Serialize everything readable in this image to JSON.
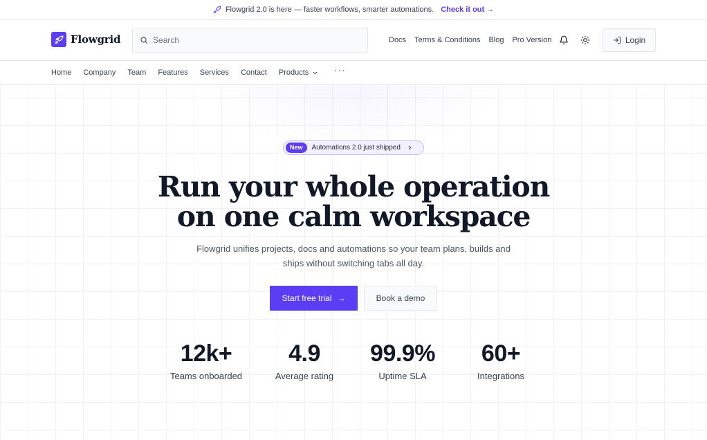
{
  "announcement": {
    "text": "Flowgrid 2.0 is here — faster workflows, smarter automations.",
    "link": "Check it out",
    "link_arrow": "→"
  },
  "header": {
    "brand": "Flowgrid",
    "search_placeholder": "Search",
    "nav": [
      "Docs",
      "Terms & Conditions",
      "Blog",
      "Pro Version"
    ],
    "login": "Login"
  },
  "subnav": {
    "items": [
      "Home",
      "Company",
      "Team",
      "Features",
      "Services",
      "Contact"
    ],
    "products": "Products",
    "more": "···"
  },
  "hero": {
    "badge_new": "New",
    "badge_text": "Automations 2.0 just shipped",
    "headline_line1": "Run your whole operation",
    "headline_line2": "on one calm workspace",
    "subcopy": "Flowgrid unifies projects, docs and automations so your team plans, builds and ships without switching tabs all day.",
    "primary_cta": "Start free trial",
    "primary_arrow": "→",
    "secondary_cta": "Book a demo"
  },
  "stats": [
    {
      "value": "12k+",
      "label": "Teams onboarded"
    },
    {
      "value": "4.9",
      "label": "Average rating"
    },
    {
      "value": "99.9%",
      "label": "Uptime SLA"
    },
    {
      "value": "60+",
      "label": "Integrations"
    }
  ],
  "colors": {
    "accent": "#5b3df5",
    "text": "#111827",
    "muted": "#4b5563",
    "border": "#e5e7eb"
  },
  "icons": {
    "announcement": "rocket-icon",
    "logo": "rocket-icon",
    "search": "search-icon",
    "notifications": "bell-icon",
    "theme": "sun-icon",
    "login": "login-icon",
    "products": "chevron-down-icon",
    "badge": "chevron-right-icon"
  }
}
